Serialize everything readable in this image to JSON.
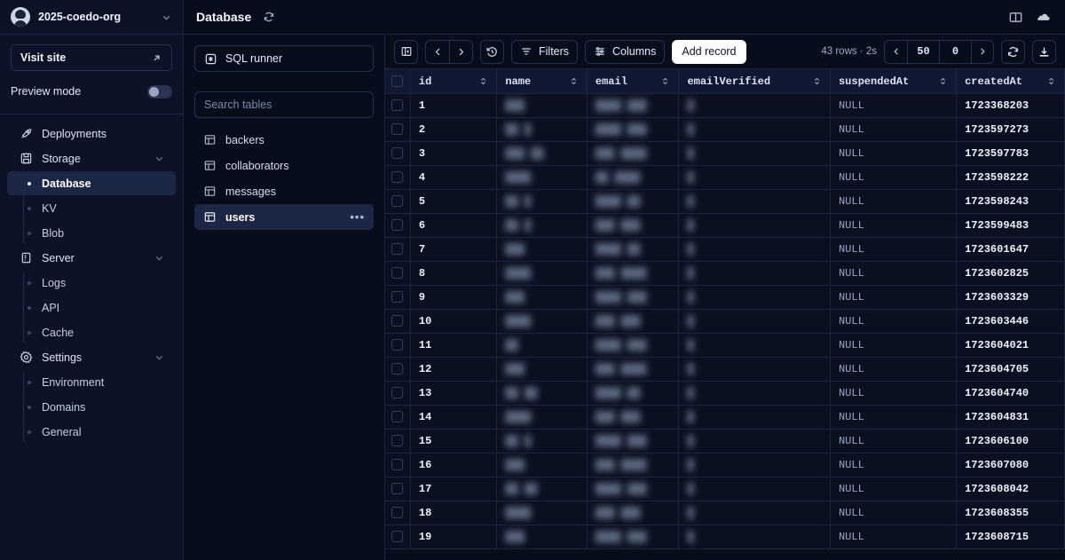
{
  "sidebar": {
    "org": {
      "name": "2025-coedo-org",
      "icon": "avatar",
      "chevron": "chevron-down-icon"
    },
    "visit_site": {
      "label": "Visit site",
      "icon": "arrow-up-right-icon"
    },
    "preview_mode": {
      "label": "Preview mode",
      "state": "off"
    },
    "nav": [
      {
        "label": "Deployments",
        "icon": "rocket-icon",
        "type": "item"
      },
      {
        "label": "Storage",
        "icon": "save-icon",
        "type": "group",
        "chevron": "chevron-down-icon"
      },
      {
        "label": "Database",
        "type": "sub",
        "active": true
      },
      {
        "label": "KV",
        "type": "sub",
        "active": false
      },
      {
        "label": "Blob",
        "type": "sub",
        "active": false
      },
      {
        "label": "Server",
        "icon": "server-icon",
        "type": "group",
        "chevron": "chevron-down-icon"
      },
      {
        "label": "Logs",
        "type": "sub",
        "active": false
      },
      {
        "label": "API",
        "type": "sub",
        "active": false
      },
      {
        "label": "Cache",
        "type": "sub",
        "active": false
      },
      {
        "label": "Settings",
        "icon": "gear-icon",
        "type": "group",
        "chevron": "chevron-down-icon"
      },
      {
        "label": "Environment",
        "type": "sub",
        "active": false
      },
      {
        "label": "Domains",
        "type": "sub",
        "active": false
      },
      {
        "label": "General",
        "type": "sub",
        "active": false
      }
    ]
  },
  "topbar": {
    "title": "Database",
    "refresh_icon": "refresh-icon",
    "docs_icon": "book-icon",
    "cloud_icon": "cloud-icon"
  },
  "tables_pane": {
    "sql_runner": {
      "label": "SQL runner",
      "icon": "sql-icon"
    },
    "search": {
      "placeholder": "Search tables"
    },
    "tables": [
      {
        "label": "backers",
        "icon": "table-icon",
        "active": false
      },
      {
        "label": "collaborators",
        "icon": "table-icon",
        "active": false
      },
      {
        "label": "messages",
        "icon": "table-icon",
        "active": false
      },
      {
        "label": "users",
        "icon": "table-icon",
        "active": true,
        "more": "•••"
      }
    ]
  },
  "toolbar": {
    "sidebar_toggle_icon": "panel-left-icon",
    "prev_icon": "chevron-left-icon",
    "next_icon": "chevron-right-icon",
    "history_icon": "history-icon",
    "filters": {
      "label": "Filters",
      "icon": "filter-icon"
    },
    "columns": {
      "label": "Columns",
      "icon": "sliders-icon"
    },
    "add_record": {
      "label": "Add record"
    },
    "rows_info": "43 rows · 2s",
    "pager": {
      "prev_icon": "chevron-left-icon",
      "limit": "50",
      "offset": "0",
      "next_icon": "chevron-right-icon"
    },
    "refresh_icon": "refresh-icon",
    "download_icon": "download-icon"
  },
  "table": {
    "select_all": false,
    "columns": [
      {
        "key": "id",
        "label": "id",
        "sortable": true
      },
      {
        "key": "name",
        "label": "name",
        "sortable": true
      },
      {
        "key": "email",
        "label": "email",
        "sortable": true
      },
      {
        "key": "emailVerified",
        "label": "emailVerified",
        "sortable": true
      },
      {
        "key": "suspendedAt",
        "label": "suspendedAt",
        "sortable": true
      },
      {
        "key": "createdAt",
        "label": "createdAt",
        "sortable": true
      }
    ],
    "rows": [
      {
        "id": "1",
        "name": "███",
        "email": "████ ███",
        "emailVerified": "█",
        "suspendedAt": "NULL",
        "createdAt": "1723368203"
      },
      {
        "id": "2",
        "name": "██ █",
        "email": "████ ███",
        "emailVerified": "█",
        "suspendedAt": "NULL",
        "createdAt": "1723597273"
      },
      {
        "id": "3",
        "name": "███ ██",
        "email": "███ ████",
        "emailVerified": "█",
        "suspendedAt": "NULL",
        "createdAt": "1723597783"
      },
      {
        "id": "4",
        "name": "████",
        "email": "██ ████",
        "emailVerified": "█",
        "suspendedAt": "NULL",
        "createdAt": "1723598222"
      },
      {
        "id": "5",
        "name": "██ █",
        "email": "████ ██",
        "emailVerified": "█",
        "suspendedAt": "NULL",
        "createdAt": "1723598243"
      },
      {
        "id": "6",
        "name": "██ █",
        "email": "███ ███",
        "emailVerified": "█",
        "suspendedAt": "NULL",
        "createdAt": "1723599483"
      },
      {
        "id": "7",
        "name": "███",
        "email": "████ ██",
        "emailVerified": "█",
        "suspendedAt": "NULL",
        "createdAt": "1723601647"
      },
      {
        "id": "8",
        "name": "████",
        "email": "███ ████",
        "emailVerified": "█",
        "suspendedAt": "NULL",
        "createdAt": "1723602825"
      },
      {
        "id": "9",
        "name": "███",
        "email": "████ ███",
        "emailVerified": "█",
        "suspendedAt": "NULL",
        "createdAt": "1723603329"
      },
      {
        "id": "10",
        "name": "████",
        "email": "███ ███",
        "emailVerified": "█",
        "suspendedAt": "NULL",
        "createdAt": "1723603446"
      },
      {
        "id": "11",
        "name": "██",
        "email": "████ ███",
        "emailVerified": "█",
        "suspendedAt": "NULL",
        "createdAt": "1723604021"
      },
      {
        "id": "12",
        "name": "███",
        "email": "███ ████",
        "emailVerified": "█",
        "suspendedAt": "NULL",
        "createdAt": "1723604705"
      },
      {
        "id": "13",
        "name": "██ ██",
        "email": "████ ██",
        "emailVerified": "█",
        "suspendedAt": "NULL",
        "createdAt": "1723604740"
      },
      {
        "id": "14",
        "name": "████",
        "email": "███ ███",
        "emailVerified": "█",
        "suspendedAt": "NULL",
        "createdAt": "1723604831"
      },
      {
        "id": "15",
        "name": "██ █",
        "email": "████ ███",
        "emailVerified": "█",
        "suspendedAt": "NULL",
        "createdAt": "1723606100"
      },
      {
        "id": "16",
        "name": "███",
        "email": "███ ████",
        "emailVerified": "█",
        "suspendedAt": "NULL",
        "createdAt": "1723607080"
      },
      {
        "id": "17",
        "name": "██ ██",
        "email": "████ ███",
        "emailVerified": "█",
        "suspendedAt": "NULL",
        "createdAt": "1723608042"
      },
      {
        "id": "18",
        "name": "████",
        "email": "███ ███",
        "emailVerified": "█",
        "suspendedAt": "NULL",
        "createdAt": "1723608355"
      },
      {
        "id": "19",
        "name": "███",
        "email": "████ ███",
        "emailVerified": "█",
        "suspendedAt": "NULL",
        "createdAt": "1723608715"
      }
    ]
  },
  "colors": {
    "bg": "#080d1c",
    "sidebar_bg": "#0d1326",
    "border": "#1b2440",
    "active": "#1b2744",
    "accent_white": "#ffffff"
  }
}
